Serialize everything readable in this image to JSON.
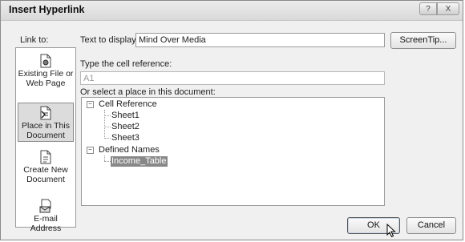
{
  "dialog": {
    "title": "Insert Hyperlink",
    "help_label": "?",
    "close_label": "X"
  },
  "link_to": {
    "label": "Link to:",
    "items": [
      {
        "line1": "Existing File or",
        "line2": "Web Page",
        "icon": "existing-file-icon"
      },
      {
        "line1": "Place in This",
        "line2": "Document",
        "icon": "place-in-document-icon"
      },
      {
        "line1": "Create New",
        "line2": "Document",
        "icon": "new-document-icon"
      },
      {
        "line1": "E-mail Address",
        "line2": "",
        "icon": "email-address-icon"
      }
    ]
  },
  "text_to_display": {
    "label": "Text to display:",
    "value": "Mind Over Media"
  },
  "screentip_label": "ScreenTip...",
  "cell_reference": {
    "label": "Type the cell reference:",
    "value": "A1"
  },
  "place_selector": {
    "label": "Or select a place in this document:",
    "tree": {
      "group1": "Cell Reference",
      "sheets": [
        "Sheet1",
        "Sheet2",
        "Sheet3"
      ],
      "group2": "Defined Names",
      "names": [
        "Income_Table"
      ]
    }
  },
  "ok_label": "OK",
  "cancel_label": "Cancel"
}
